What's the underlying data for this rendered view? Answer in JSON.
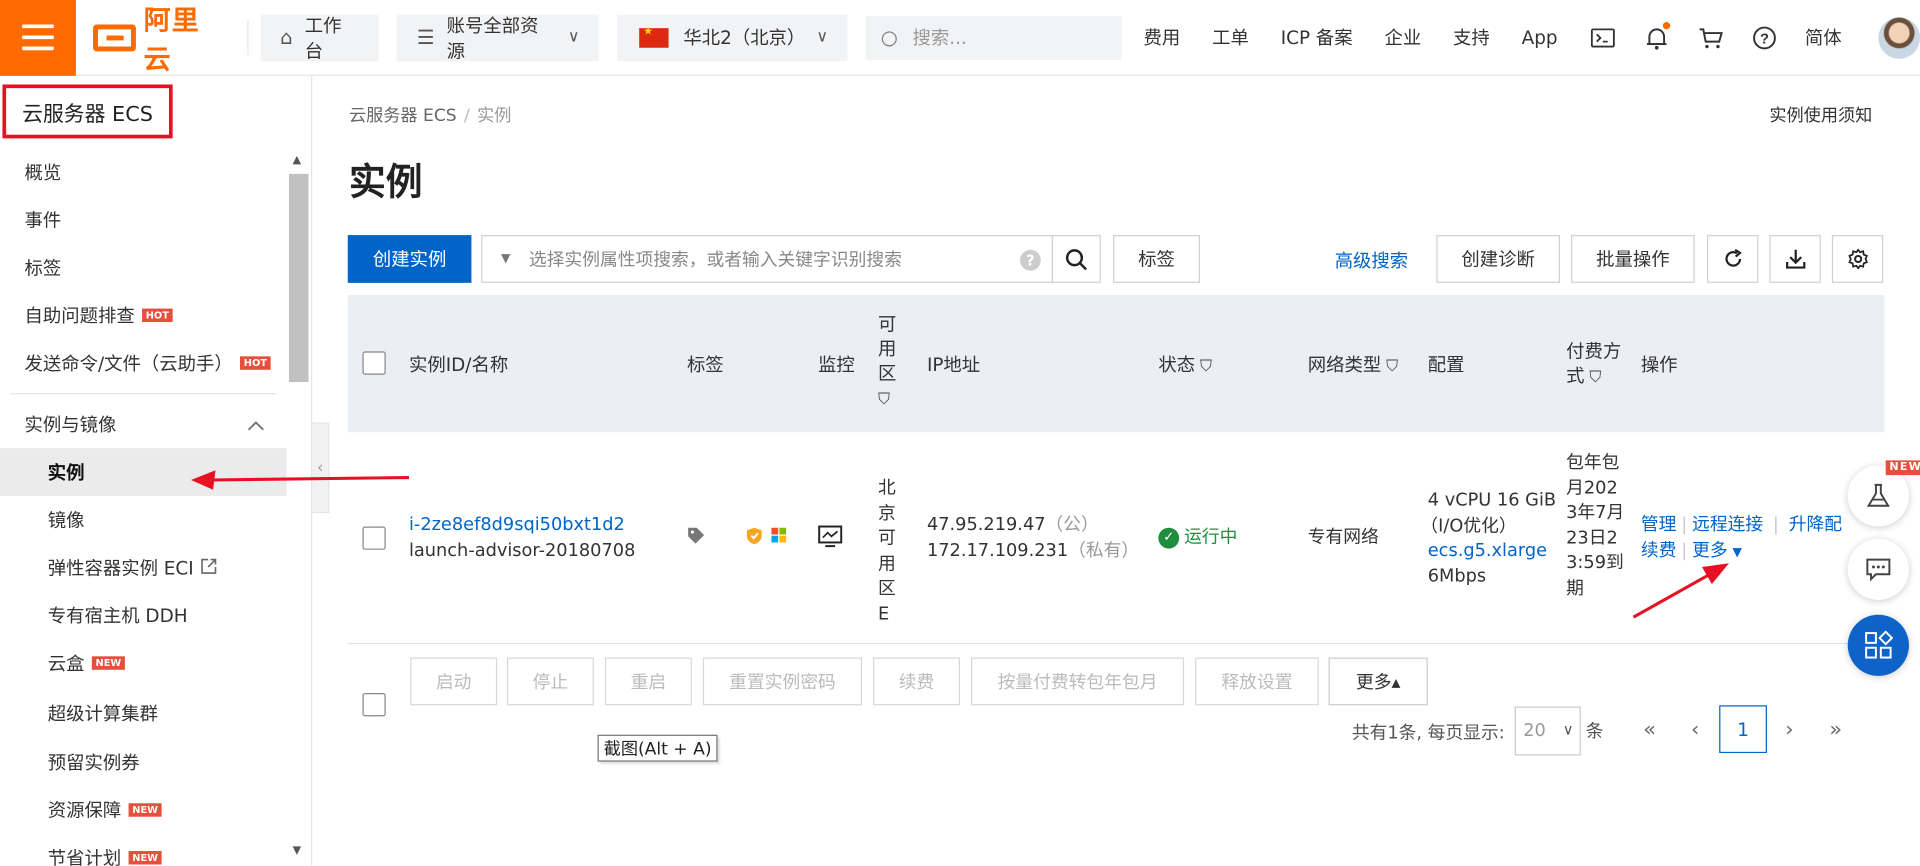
{
  "topbar": {
    "logo_text": "阿里云",
    "workbench": "工作台",
    "resources": "账号全部资源",
    "region": "华北2（北京）",
    "search_placeholder": "搜索...",
    "nav": [
      "费用",
      "工单",
      "ICP 备案",
      "企业",
      "支持",
      "App"
    ],
    "lang": "简体"
  },
  "sidebar": {
    "title": "云服务器 ECS",
    "items": [
      {
        "label": "概览"
      },
      {
        "label": "事件"
      },
      {
        "label": "标签"
      },
      {
        "label": "自助问题排查",
        "badge": "HOT"
      },
      {
        "label": "发送命令/文件（云助手）",
        "badge": "HOT"
      }
    ],
    "group": "实例与镜像",
    "sub_items": [
      {
        "label": "实例"
      },
      {
        "label": "镜像"
      },
      {
        "label": "弹性容器实例 ECI"
      },
      {
        "label": "专有宿主机 DDH"
      },
      {
        "label": "云盒",
        "badge": "NEW"
      },
      {
        "label": "超级计算集群"
      },
      {
        "label": "预留实例券"
      },
      {
        "label": "资源保障",
        "badge": "NEW"
      },
      {
        "label": "节省计划",
        "badge": "NEW"
      }
    ]
  },
  "main": {
    "breadcrumb": [
      "云服务器 ECS",
      "实例"
    ],
    "notice": "实例使用须知",
    "title": "实例",
    "toolbar": {
      "create": "创建实例",
      "filter_placeholder": "选择实例属性项搜索，或者输入关键字识别搜索",
      "tag": "标签",
      "advanced": "高级搜索",
      "diagnose": "创建诊断",
      "batch": "批量操作"
    },
    "table": {
      "headers": {
        "id": "实例ID/名称",
        "tag": "标签",
        "monitor": "监控",
        "zone": "可用区",
        "ip": "IP地址",
        "status": "状态",
        "network": "网络类型",
        "config": "配置",
        "billing": "付费方式",
        "ops": "操作"
      },
      "rows": [
        {
          "id": "i-2ze8ef8d9sqi50bxt1d2",
          "name": "launch-advisor-20180708",
          "zone": "北京可用区E",
          "ip_public": "47.95.219.47",
          "ip_public_tag": "（公）",
          "ip_private": "172.17.109.231",
          "ip_private_tag": "（私有）",
          "status": "运行中",
          "network": "专有网络",
          "config_spec": "4 vCPU 16 GiB",
          "config_io": "（I/O优化）",
          "config_type": "ecs.g5.xlarge",
          "config_bw": "6Mbps",
          "billing": "包年包月2023年7月23日23:59到期",
          "ops": {
            "manage": "管理",
            "remote": "远程连接",
            "upgrade": "升降配",
            "renew": "续费",
            "more": "更多"
          }
        }
      ]
    },
    "batch_buttons": [
      "启动",
      "停止",
      "重启",
      "重置实例密码",
      "续费",
      "按量付费转包年包月",
      "释放设置"
    ],
    "batch_more": "更多▴",
    "tooltip": "截图(Alt + A)",
    "pager": {
      "info": "共有1条, 每页显示:",
      "size": "20",
      "unit": "条",
      "current": "1"
    },
    "float_new": "NEW"
  }
}
